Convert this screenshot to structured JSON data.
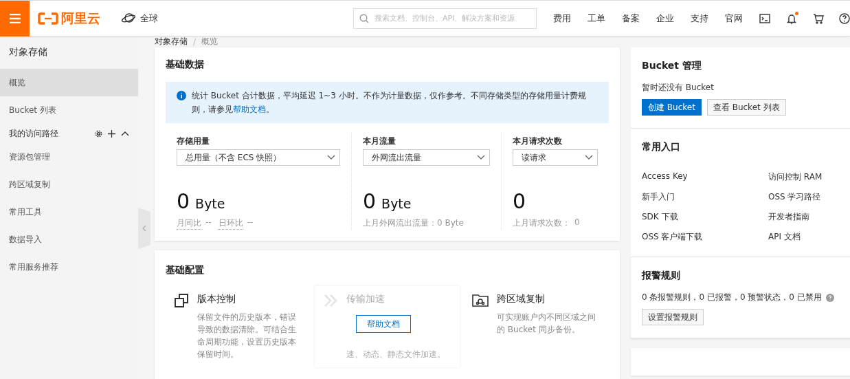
{
  "header": {
    "brand": "阿里云",
    "region": "全球",
    "search": {
      "placeholder": "搜索文档、控制台、API、解决方案和资源"
    },
    "nav": [
      "费用",
      "工单",
      "备案",
      "企业",
      "支持",
      "官网"
    ],
    "notification_dot": true
  },
  "sidebar": {
    "title": "对象存储",
    "items": [
      {
        "label": "概览",
        "kind": "link",
        "selected": true
      },
      {
        "label": "Bucket 列表",
        "kind": "link",
        "selected": false
      },
      {
        "label": "我的访问路径",
        "kind": "group",
        "expanded": true
      },
      {
        "label": "资源包管理",
        "kind": "link",
        "selected": false
      },
      {
        "label": "跨区域复制",
        "kind": "link",
        "selected": false
      },
      {
        "label": "常用工具",
        "kind": "link",
        "selected": false
      },
      {
        "label": "数据导入",
        "kind": "link",
        "selected": false
      },
      {
        "label": "常用服务推荐",
        "kind": "link",
        "selected": false
      }
    ]
  },
  "breadcrumb": [
    "对象存储",
    "概览"
  ],
  "breadcrumb_separator": "/",
  "basic_data": {
    "title": "基础数据",
    "notice": {
      "text": "统计 Bucket 合计数据，平均延迟 1~3 小时。不作为计量数据，仅作参考。不同存储类型的存储用量计费规则，请参见",
      "link": "帮助文档",
      "end": "。"
    },
    "metrics": [
      {
        "label": "存储用量",
        "select": "总用量（不含 ECS 快照）",
        "value": "0",
        "unit": "Byte",
        "footer": [
          {
            "label": "月同比",
            "value": "--"
          },
          {
            "label": "日环比",
            "value": "--"
          }
        ]
      },
      {
        "label": "本月流量",
        "select": "外网流出流量",
        "value": "0",
        "unit": "Byte",
        "footer": [
          {
            "label": "上月外网流出流量：0 Byte"
          }
        ]
      },
      {
        "label": "本月请求次数",
        "select": "读请求",
        "value": "0",
        "footer": [
          {
            "label": "上月请求次数：",
            "value": "0"
          }
        ]
      }
    ]
  },
  "basic_config": {
    "title": "基础配置",
    "features": [
      {
        "kind": "versions",
        "title": "版本控制",
        "description": "保留文件的历史版本，错误导致的数据清除。可结合生命周期功能，设置历史版本保留时间。",
        "disabled": false
      },
      {
        "kind": "accelerate",
        "title": "传输加速",
        "description": "速、动态、静态文件加速。",
        "disabled": true,
        "overlay_button": "帮助文档"
      },
      {
        "kind": "replication",
        "title": "跨区域复制",
        "description": "可实现账户内不同区域之间的 Bucket 同步备份。",
        "disabled": false
      }
    ]
  },
  "bucket_panel": {
    "title": "Bucket 管理",
    "empty_text": "暂时还没有 Bucket",
    "buttons": [
      {
        "label": "创建 Bucket",
        "kind": "primary"
      },
      {
        "label": "查看 Bucket 列表",
        "kind": "secondary"
      }
    ]
  },
  "shortcuts": {
    "title": "常用入口",
    "links": [
      "Access Key",
      "访问控制 RAM",
      "新手入门",
      "OSS 学习路径",
      "SDK 下载",
      "开发者指南",
      "OSS 客户端下载",
      "API 文档"
    ]
  },
  "alarm": {
    "title": "报警规则",
    "summary": "0 条报警规则，0 已报警，0 预警状态，0 已禁用",
    "button": "设置报警规则"
  }
}
